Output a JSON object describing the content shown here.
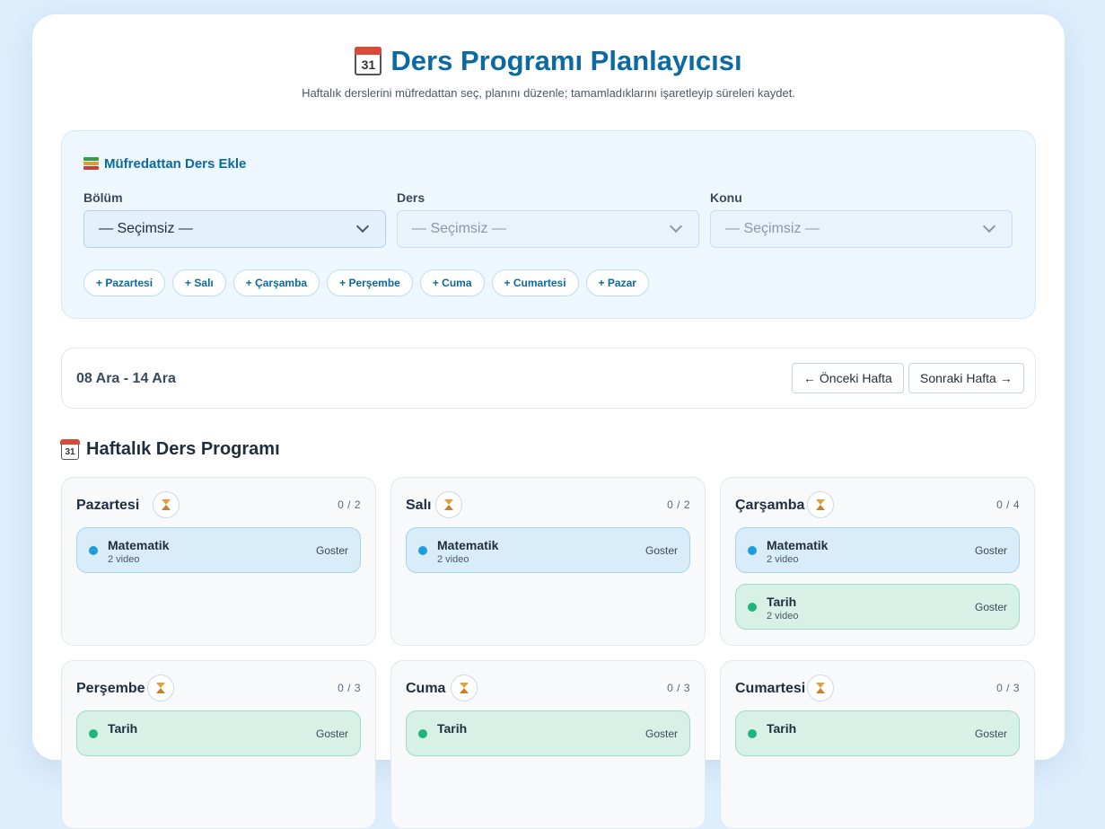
{
  "header": {
    "title": "Ders Programı Planlayıcısı",
    "calendar_day": "31",
    "subtitle": "Haftalık derslerini müfredattan seç, planını düzenle; tamamladıklarını işaretleyip süreleri kaydet."
  },
  "add_panel": {
    "title": "Müfredattan Ders Ekle",
    "fields": [
      {
        "label": "Bölüm",
        "value": "— Seçimsiz —"
      },
      {
        "label": "Ders",
        "value": "— Seçimsiz —"
      },
      {
        "label": "Konu",
        "value": "— Seçimsiz —"
      }
    ],
    "day_buttons": [
      "+ Pazartesi",
      "+ Salı",
      "+ Çarşamba",
      "+ Perşembe",
      "+ Cuma",
      "+ Cumartesi",
      "+ Pazar"
    ]
  },
  "week_nav": {
    "range": "08 Ara - 14 Ara",
    "prev_label": "← Önceki Hafta",
    "next_label": "Sonraki Hafta →"
  },
  "schedule": {
    "title": "Haftalık Ders Programı",
    "days": [
      {
        "name": "Pazartesi",
        "count": "0 / 2",
        "lessons": [
          {
            "name": "Matematik",
            "sub": "2 video",
            "link": "Goster",
            "color": "blue"
          }
        ]
      },
      {
        "name": "Salı",
        "count": "0 / 2",
        "lessons": [
          {
            "name": "Matematik",
            "sub": "2 video",
            "link": "Goster",
            "color": "blue"
          }
        ]
      },
      {
        "name": "Çarşamba",
        "count": "0 / 4",
        "lessons": [
          {
            "name": "Matematik",
            "sub": "2 video",
            "link": "Goster",
            "color": "blue"
          },
          {
            "name": "Tarih",
            "sub": "2 video",
            "link": "Goster",
            "color": "green"
          }
        ]
      },
      {
        "name": "Perşembe",
        "count": "0 / 3",
        "lessons": [
          {
            "name": "Tarih",
            "sub": "",
            "link": "Goster",
            "color": "green"
          }
        ]
      },
      {
        "name": "Cuma",
        "count": "0 / 3",
        "lessons": [
          {
            "name": "Tarih",
            "sub": "",
            "link": "Goster",
            "color": "green"
          }
        ]
      },
      {
        "name": "Cumartesi",
        "count": "0 / 3",
        "lessons": [
          {
            "name": "Tarih",
            "sub": "",
            "link": "Goster",
            "color": "green"
          }
        ]
      }
    ]
  },
  "colors": {
    "accent": "#0b6aa2",
    "blue_dot": "#1f9be0",
    "green_dot": "#1fb57e"
  }
}
